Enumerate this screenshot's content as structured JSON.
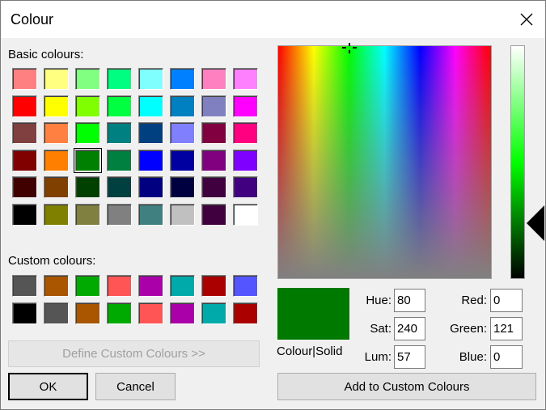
{
  "window": {
    "title": "Colour"
  },
  "labels": {
    "basic_colours": "Basic colours:",
    "custom_colours": "Custom colours:",
    "colour_solid": "Colour|Solid",
    "hue": "Hue:",
    "sat": "Sat:",
    "lum": "Lum:",
    "red": "Red:",
    "green": "Green:",
    "blue": "Blue:"
  },
  "buttons": {
    "define_custom": "Define Custom Colours >>",
    "ok": "OK",
    "cancel": "Cancel",
    "add_custom": "Add to Custom Colours"
  },
  "values": {
    "hue": "80",
    "sat": "240",
    "lum": "57",
    "red": "0",
    "green": "121",
    "blue": "0"
  },
  "current_colour": "#007900",
  "basic_colours": [
    [
      "#ff8080",
      "#ffff80",
      "#80ff80",
      "#00ff80",
      "#80ffff",
      "#0080ff",
      "#ff80c0",
      "#ff80ff"
    ],
    [
      "#ff0000",
      "#ffff00",
      "#80ff00",
      "#00ff40",
      "#00ffff",
      "#0080c0",
      "#8080c0",
      "#ff00ff"
    ],
    [
      "#804040",
      "#ff8040",
      "#00ff00",
      "#008080",
      "#004080",
      "#8080ff",
      "#800040",
      "#ff0080"
    ],
    [
      "#800000",
      "#ff8000",
      "#008000",
      "#008040",
      "#0000ff",
      "#0000a0",
      "#800080",
      "#8000ff"
    ],
    [
      "#400000",
      "#804000",
      "#004000",
      "#004040",
      "#000080",
      "#000040",
      "#400040",
      "#400080"
    ],
    [
      "#000000",
      "#808000",
      "#808040",
      "#808080",
      "#408080",
      "#c0c0c0",
      "#400040",
      "#ffffff"
    ]
  ],
  "selected_basic": [
    3,
    2
  ],
  "custom_colours": [
    [
      "#555555",
      "#aa5500",
      "#00aa00",
      "#ff5555",
      "#aa00aa",
      "#00aaaa",
      "#aa0000",
      "#5555ff"
    ],
    [
      "#000000",
      "#555555",
      "#aa5500",
      "#00aa00",
      "#ff5555",
      "#aa00aa",
      "#00aaaa",
      "#aa0000"
    ]
  ]
}
